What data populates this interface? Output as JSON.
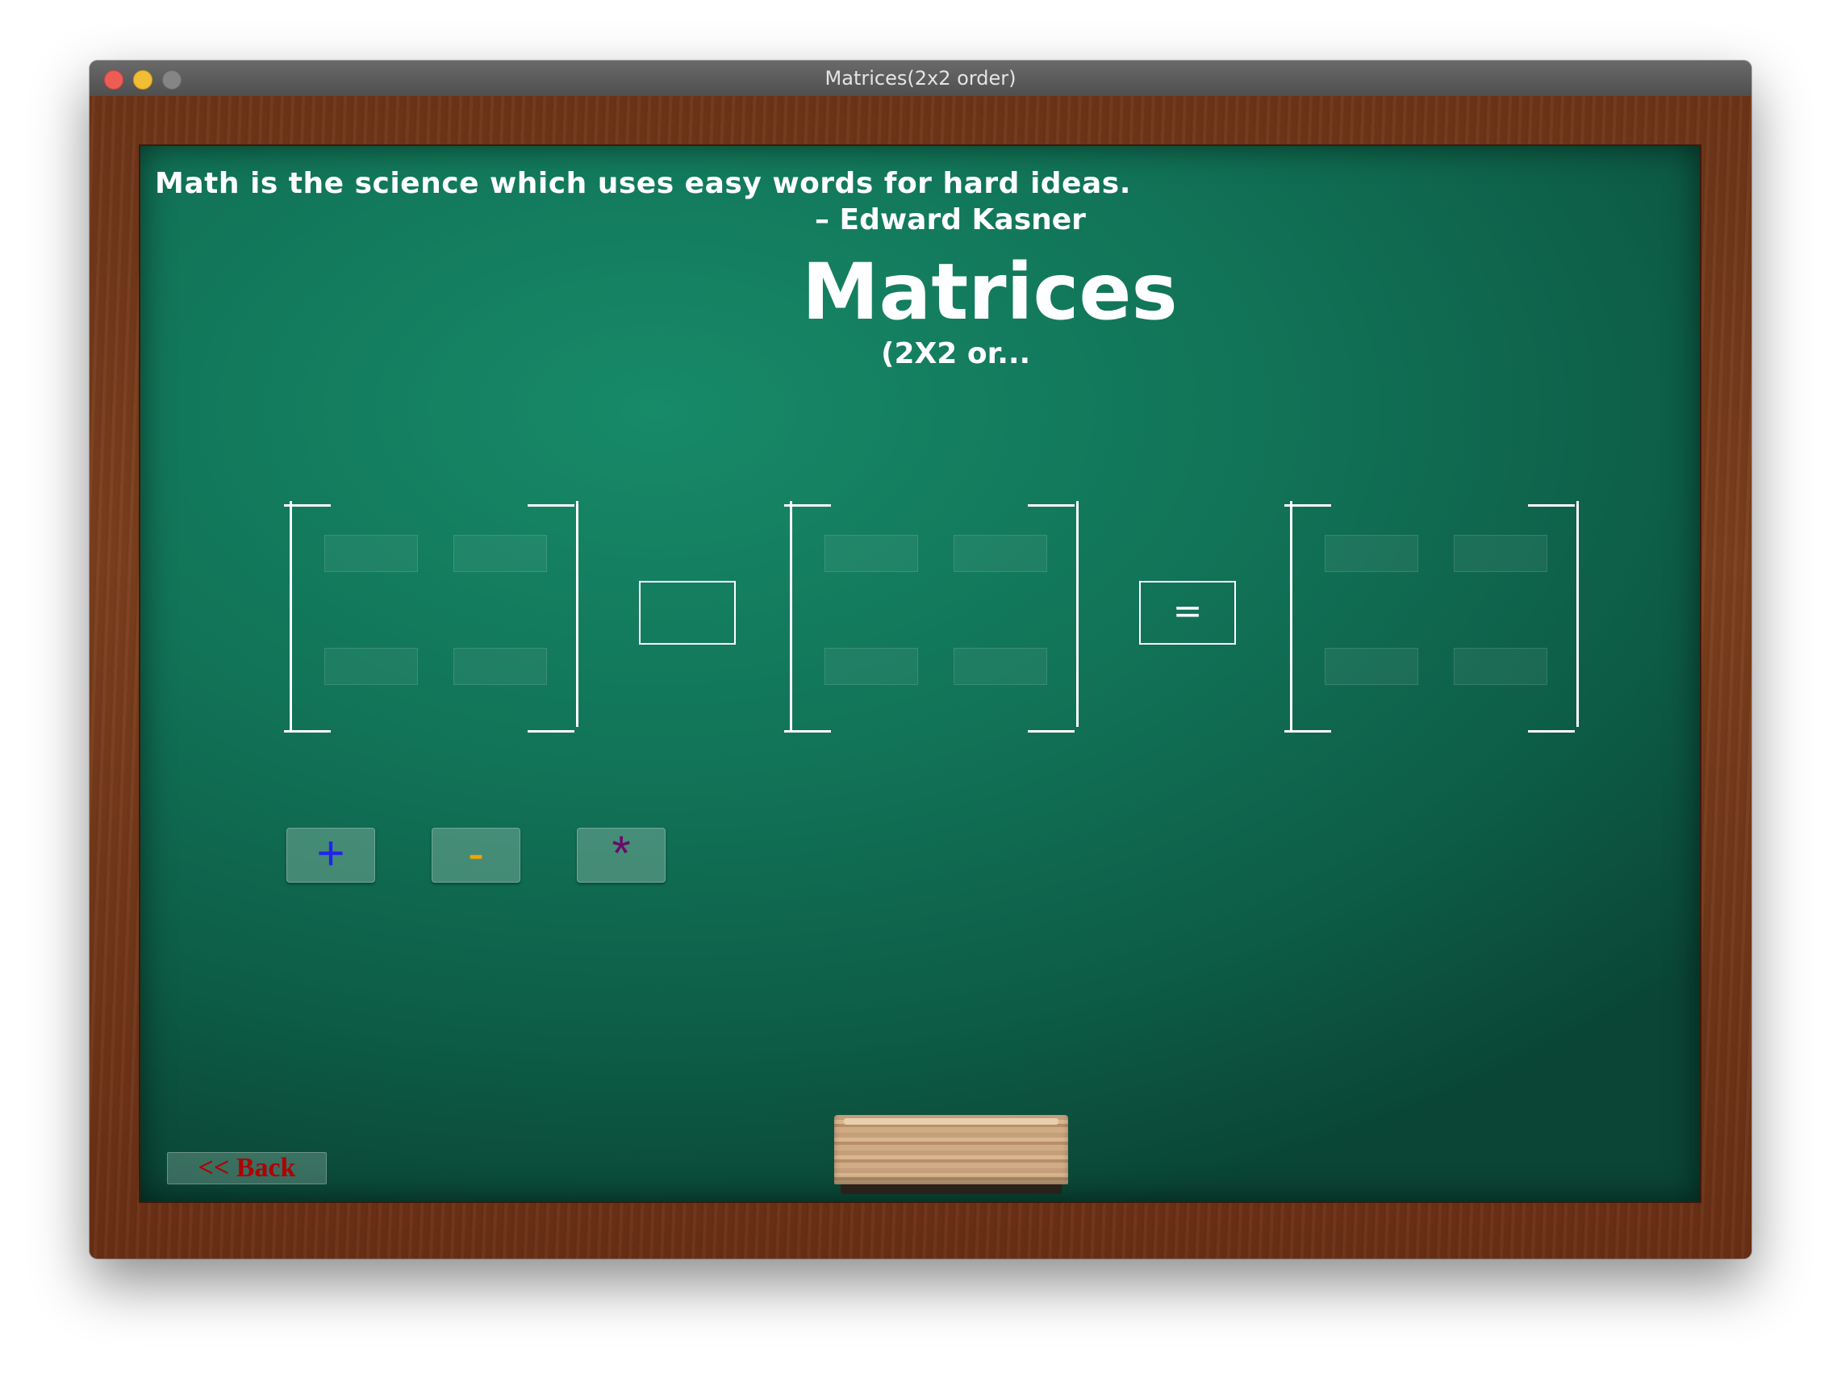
{
  "window": {
    "title": "Matrices(2x2 order)"
  },
  "board": {
    "quote": "Math is the science which uses easy words for hard ideas.",
    "author": "– Edward Kasner",
    "title": "Matrices",
    "subtitle": "(2X2 or..."
  },
  "calculator": {
    "operator_display": "",
    "equals_label": "=",
    "matrix_a": [
      [
        "",
        ""
      ],
      [
        "",
        ""
      ]
    ],
    "matrix_b": [
      [
        "",
        ""
      ],
      [
        "",
        ""
      ]
    ],
    "result": [
      [
        "",
        ""
      ],
      [
        "",
        ""
      ]
    ]
  },
  "operations": [
    {
      "label": "+",
      "color": "#2222ee"
    },
    {
      "label": "-",
      "color": "#f5a300"
    },
    {
      "label": "*",
      "color": "#6a0a6a"
    }
  ],
  "back_button": {
    "label": "<<  Back",
    "color": "#b00000"
  },
  "colors": {
    "board": "#137a5c",
    "frame": "#6e3518",
    "chalk": "#ffffff"
  }
}
